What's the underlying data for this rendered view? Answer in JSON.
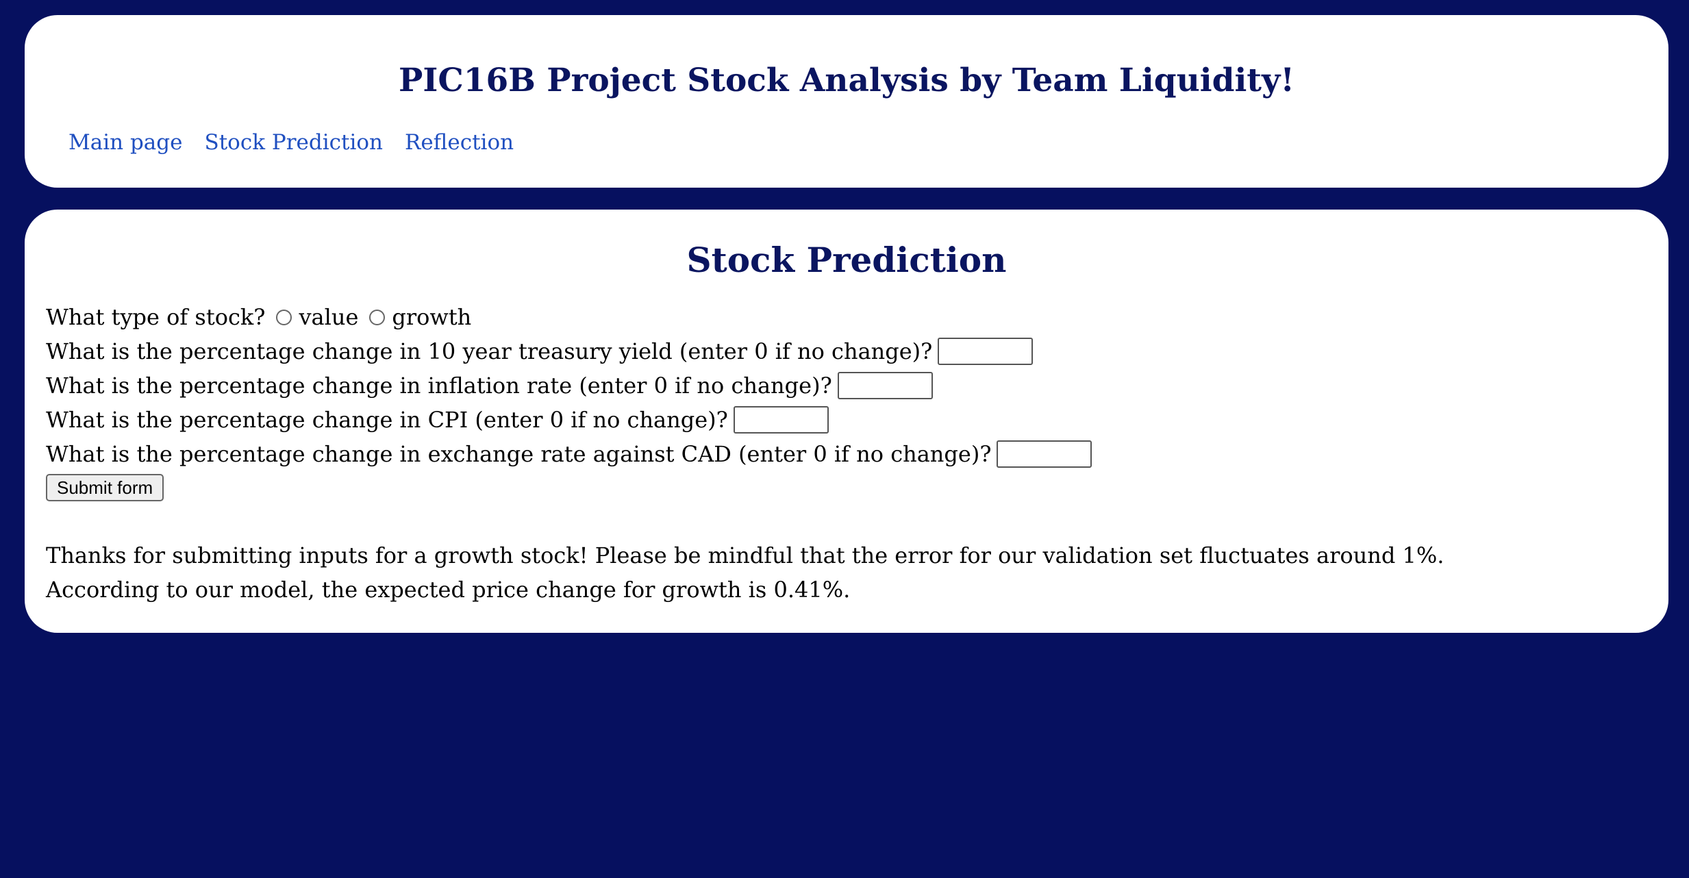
{
  "header": {
    "title": "PIC16B Project Stock Analysis by Team Liquidity!",
    "nav": [
      {
        "label": "Main page"
      },
      {
        "label": "Stock Prediction"
      },
      {
        "label": "Reflection"
      }
    ]
  },
  "main": {
    "title": "Stock Prediction",
    "form": {
      "stock_type_question": "What type of stock?",
      "stock_type_options": [
        "value",
        "growth"
      ],
      "treasury_question": "What is the percentage change in 10 year treasury yield (enter 0 if no change)?",
      "treasury_value": "",
      "inflation_question": "What is the percentage change in inflation rate (enter 0 if no change)?",
      "inflation_value": "",
      "cpi_question": "What is the percentage change in CPI (enter 0 if no change)?",
      "cpi_value": "",
      "exchange_question": "What is the percentage change in exchange rate against CAD (enter 0 if no change)?",
      "exchange_value": "",
      "submit_label": "Submit form"
    },
    "result": {
      "line1": "Thanks for submitting inputs for a growth stock! Please be mindful that the error for our validation set fluctuates around 1%.",
      "line2": "According to our model, the expected price change for growth is 0.41%."
    }
  },
  "colors": {
    "background": "#06105f",
    "heading": "#0a1560",
    "link": "#1f4fc0",
    "card": "#ffffff"
  }
}
